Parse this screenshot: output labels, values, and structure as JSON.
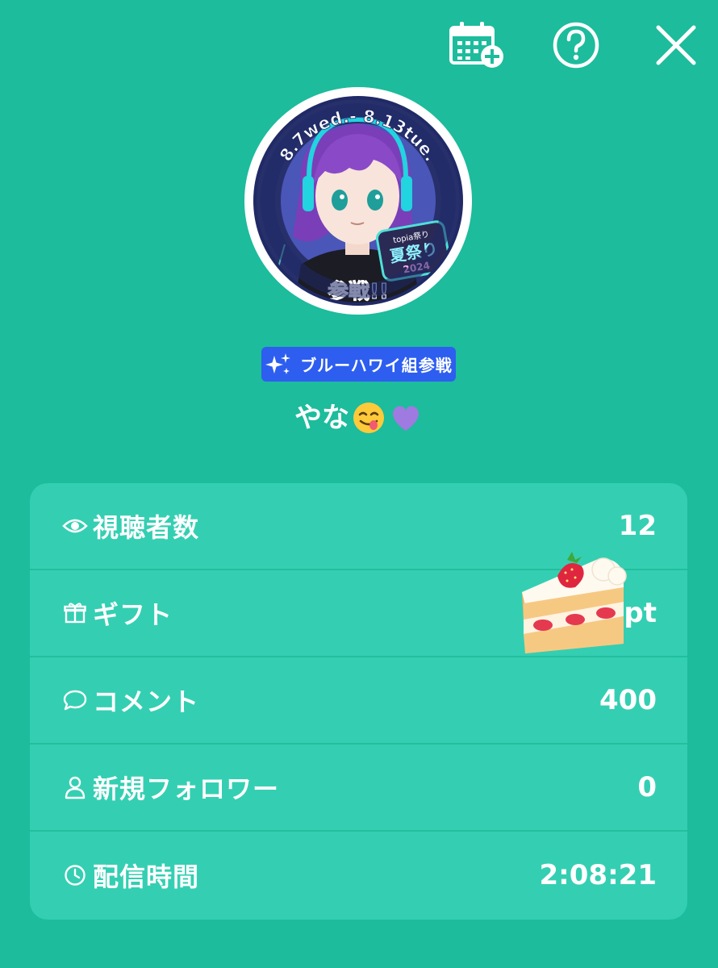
{
  "header": {
    "icons": [
      "calendar-add-icon",
      "help-icon",
      "close-icon"
    ]
  },
  "avatar": {
    "banner_dates": "8.7wed.- 8.13tue.",
    "badge_top": "topia祭り",
    "badge_main": "夏祭り",
    "badge_year": "2024",
    "banner_bottom": "参戦!!"
  },
  "badge": {
    "icon": "sparkles-icon",
    "label": "ブルーハワイ組参戦",
    "color": "#2d5ef0"
  },
  "user": {
    "name": "やな",
    "emoji": [
      "face-savoring-food-emoji",
      "purple-heart-emoji"
    ]
  },
  "stats": {
    "viewers": {
      "icon": "eye-icon",
      "label": "視聴者数",
      "value": "12"
    },
    "gifts": {
      "icon": "gift-icon",
      "label": "ギフト",
      "value": "pt"
    },
    "comments": {
      "icon": "comment-icon",
      "label": "コメント",
      "value": "400"
    },
    "new_followers": {
      "icon": "person-icon",
      "label": "新規フォロワー",
      "value": "0"
    },
    "stream_time": {
      "icon": "clock-icon",
      "label": "配信時間",
      "value": "2:08:21"
    }
  },
  "overlay": {
    "sticker": "shortcake-emoji"
  },
  "colors": {
    "background": "#1cbc9c",
    "card": "#34cfb2",
    "divider": "#22bf9f",
    "text": "#ffffff"
  }
}
